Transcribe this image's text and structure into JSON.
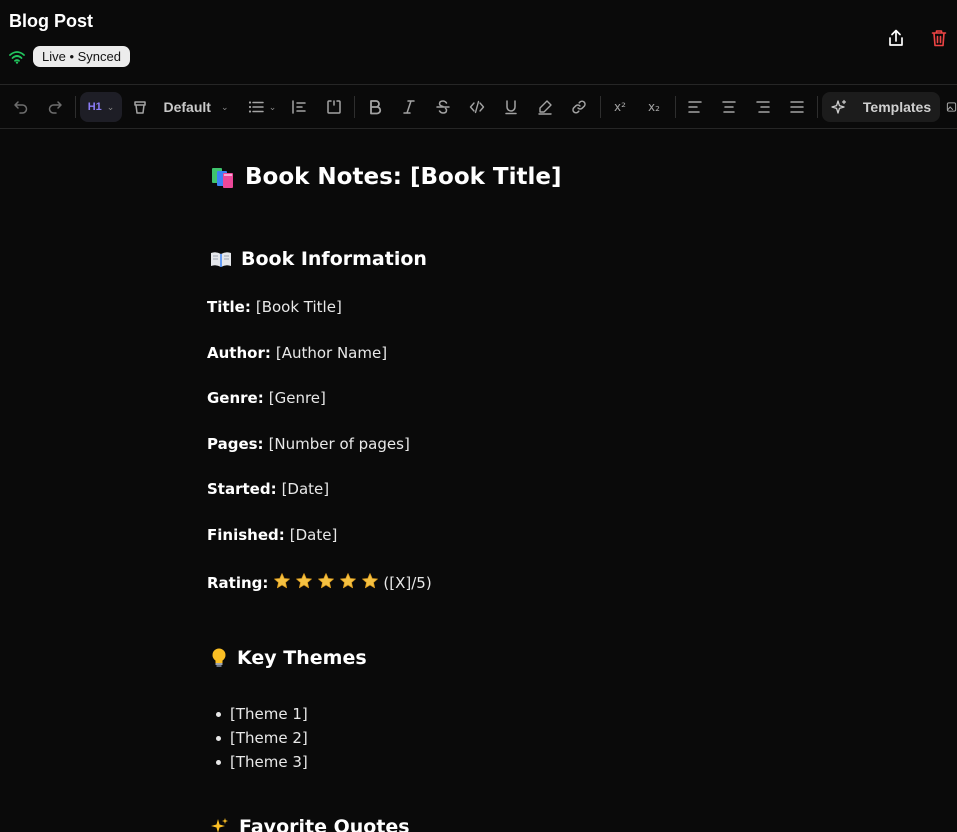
{
  "header": {
    "title": "Blog Post",
    "status": "Live • Synced"
  },
  "toolbar": {
    "heading_label": "H1",
    "style_select": "Default",
    "superscript_label": "x²",
    "subscript_label": "x₂",
    "templates_label": "Templates"
  },
  "doc": {
    "title": "Book Notes: [Book Title]",
    "section_info": "Book Information",
    "fields": [
      {
        "label": "Title:",
        "value": "[Book Title]"
      },
      {
        "label": "Author:",
        "value": "[Author Name]"
      },
      {
        "label": "Genre:",
        "value": "[Genre]"
      },
      {
        "label": "Pages:",
        "value": "[Number of pages]"
      },
      {
        "label": "Started:",
        "value": "[Date]"
      },
      {
        "label": "Finished:",
        "value": "[Date]"
      }
    ],
    "rating_label": "Rating:",
    "rating_stars": 5,
    "rating_value": "([X]/5)",
    "section_themes": "Key Themes",
    "themes": [
      "[Theme 1]",
      "[Theme 2]",
      "[Theme 3]"
    ],
    "section_quotes": "Favorite Quotes"
  },
  "icons": {
    "connection": "wifi-icon",
    "share": "share-icon",
    "delete": "trash-icon",
    "title_emoji": "books-icon",
    "info_emoji": "open-book-icon",
    "themes_emoji": "light-bulb-icon",
    "quotes_emoji": "sparkles-icon"
  },
  "colors": {
    "background": "#0a0a0a",
    "accent": "#8b7cf6",
    "wifi": "#22c55e",
    "delete": "#ef4444",
    "star": "#f5c142"
  }
}
